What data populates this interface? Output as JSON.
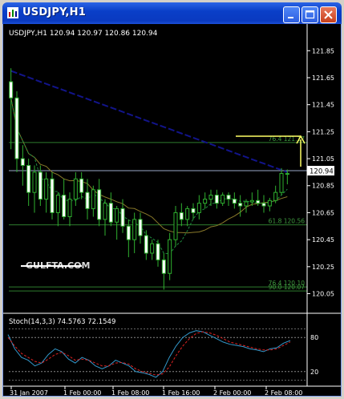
{
  "window": {
    "title": "USDJPY,H1",
    "buttons": {
      "minimize": "minimize",
      "maximize": "maximize",
      "close": "close"
    }
  },
  "chart_data": [
    {
      "type": "candlestick",
      "header": "USDJPY,H1  120.94 120.97 120.86 120.94",
      "watermark": "GULFTA.COM",
      "ylim": [
        119.97,
        122.0
      ],
      "y_ticks": [
        "121.85",
        "121.65",
        "121.45",
        "121.25",
        "121.05",
        "120.85",
        "120.65",
        "120.45",
        "120.25",
        "120.05"
      ],
      "current_price": "120.94",
      "x_ticks": [
        "31 Jan 2007",
        "1 Feb 00:00",
        "1 Feb 08:00",
        "1 Feb 16:00",
        "2 Feb 00:00",
        "2 Feb 08:00"
      ],
      "fib_levels": [
        {
          "label": "76.4  121.17",
          "value": 121.17
        },
        {
          "label": "61.8  120.56",
          "value": 120.56
        },
        {
          "label": "76.4  120.10",
          "value": 120.1
        },
        {
          "label": "90.0  120.07",
          "value": 120.07
        }
      ],
      "candles": [
        [
          121.62,
          121.72,
          121.12,
          121.5
        ],
        [
          121.5,
          121.55,
          120.95,
          121.05
        ],
        [
          121.05,
          121.15,
          120.85,
          121.0
        ],
        [
          121.0,
          121.05,
          120.7,
          120.8
        ],
        [
          120.8,
          121.0,
          120.65,
          120.95
        ],
        [
          120.95,
          121.0,
          120.7,
          120.75
        ],
        [
          120.75,
          120.95,
          120.65,
          120.9
        ],
        [
          120.9,
          120.95,
          120.6,
          120.65
        ],
        [
          120.65,
          120.8,
          120.55,
          120.78
        ],
        [
          120.78,
          120.9,
          120.6,
          120.62
        ],
        [
          120.62,
          120.8,
          120.55,
          120.75
        ],
        [
          120.75,
          120.95,
          120.7,
          120.9
        ],
        [
          120.9,
          120.95,
          120.75,
          120.8
        ],
        [
          120.8,
          120.9,
          120.6,
          120.68
        ],
        [
          120.68,
          120.85,
          120.62,
          120.82
        ],
        [
          120.82,
          120.9,
          120.55,
          120.6
        ],
        [
          120.6,
          120.75,
          120.48,
          120.72
        ],
        [
          120.72,
          120.8,
          120.55,
          120.58
        ],
        [
          120.58,
          120.7,
          120.45,
          120.68
        ],
        [
          120.68,
          120.75,
          120.5,
          120.55
        ],
        [
          120.55,
          120.6,
          120.32,
          120.45
        ],
        [
          120.45,
          120.65,
          120.35,
          120.6
        ],
        [
          120.6,
          120.65,
          120.42,
          120.48
        ],
        [
          120.48,
          120.52,
          120.3,
          120.35
        ],
        [
          120.35,
          120.45,
          120.3,
          120.42
        ],
        [
          120.42,
          120.45,
          120.25,
          120.3
        ],
        [
          120.3,
          120.35,
          120.08,
          120.2
        ],
        [
          120.2,
          120.5,
          120.15,
          120.45
        ],
        [
          120.45,
          120.7,
          120.4,
          120.65
        ],
        [
          120.65,
          120.72,
          120.55,
          120.6
        ],
        [
          120.6,
          120.7,
          120.55,
          120.68
        ],
        [
          120.68,
          120.72,
          120.6,
          120.65
        ],
        [
          120.65,
          120.78,
          120.6,
          120.72
        ],
        [
          120.72,
          120.8,
          120.68,
          120.75
        ],
        [
          120.75,
          120.82,
          120.7,
          120.78
        ],
        [
          120.78,
          120.82,
          120.68,
          120.72
        ],
        [
          120.72,
          120.8,
          120.7,
          120.78
        ],
        [
          120.78,
          120.8,
          120.7,
          120.75
        ],
        [
          120.75,
          120.8,
          120.68,
          120.72
        ],
        [
          120.72,
          120.78,
          120.62,
          120.7
        ],
        [
          120.7,
          120.75,
          120.65,
          120.73
        ],
        [
          120.73,
          120.8,
          120.7,
          120.74
        ],
        [
          120.74,
          120.82,
          120.7,
          120.72
        ],
        [
          120.72,
          120.78,
          120.65,
          120.7
        ],
        [
          120.7,
          120.76,
          120.66,
          120.74
        ],
        [
          120.74,
          120.85,
          120.72,
          120.8
        ],
        [
          120.8,
          120.98,
          120.78,
          120.94
        ],
        [
          120.94,
          120.97,
          120.86,
          120.94
        ]
      ],
      "arrow": {
        "from": 120.97,
        "to": 121.17
      }
    },
    {
      "type": "line",
      "header": "Stoch(14,3,3) 74.5763 72.1549",
      "ylim": [
        0,
        100
      ],
      "y_ticks": [
        "80",
        "20"
      ],
      "levels": [
        80,
        20
      ],
      "series": [
        {
          "name": "main",
          "color": "#3399cc",
          "values": [
            85,
            60,
            45,
            40,
            30,
            35,
            50,
            60,
            55,
            42,
            35,
            45,
            40,
            30,
            25,
            30,
            40,
            35,
            30,
            20,
            18,
            15,
            10,
            20,
            45,
            65,
            80,
            88,
            92,
            90,
            84,
            78,
            72,
            68,
            66,
            64,
            60,
            58,
            55,
            60,
            62,
            70,
            74.6
          ]
        },
        {
          "name": "signal",
          "color": "#dd2222",
          "values": [
            80,
            65,
            52,
            45,
            38,
            35,
            42,
            50,
            54,
            48,
            40,
            42,
            40,
            35,
            30,
            30,
            35,
            36,
            33,
            25,
            20,
            17,
            14,
            16,
            28,
            48,
            65,
            78,
            87,
            90,
            88,
            84,
            78,
            72,
            69,
            66,
            63,
            60,
            58,
            58,
            60,
            66,
            72.2
          ]
        }
      ]
    }
  ]
}
